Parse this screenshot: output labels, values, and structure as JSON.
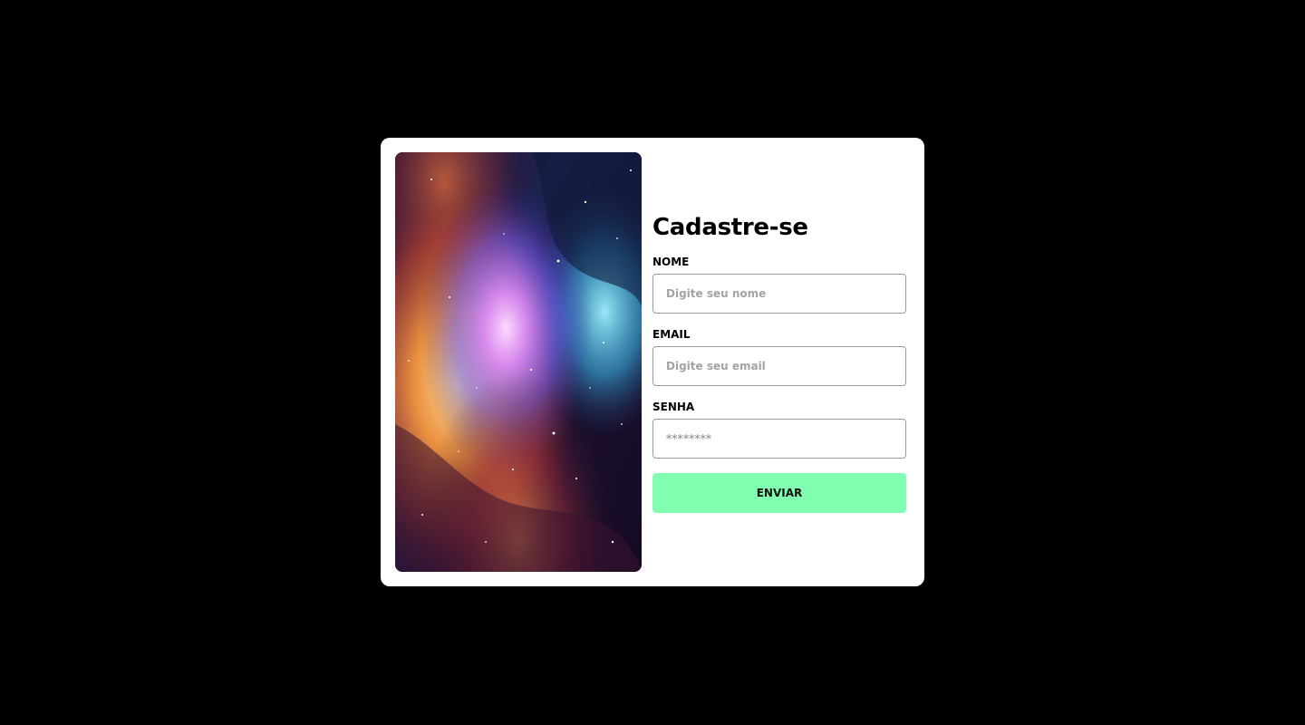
{
  "form": {
    "title": "Cadastre-se",
    "fields": [
      {
        "label": "NOME",
        "placeholder": "Digite seu nome"
      },
      {
        "label": "EMAIL",
        "placeholder": "Digite seu email"
      },
      {
        "label": "SENHA",
        "placeholder": "********"
      }
    ],
    "submit_label": "ENVIAR"
  },
  "colors": {
    "page_background": "#000000",
    "card_background": "#ffffff",
    "button_accent": "#7fffaf"
  },
  "image": {
    "subject": "nebula-galaxy-illustration"
  }
}
